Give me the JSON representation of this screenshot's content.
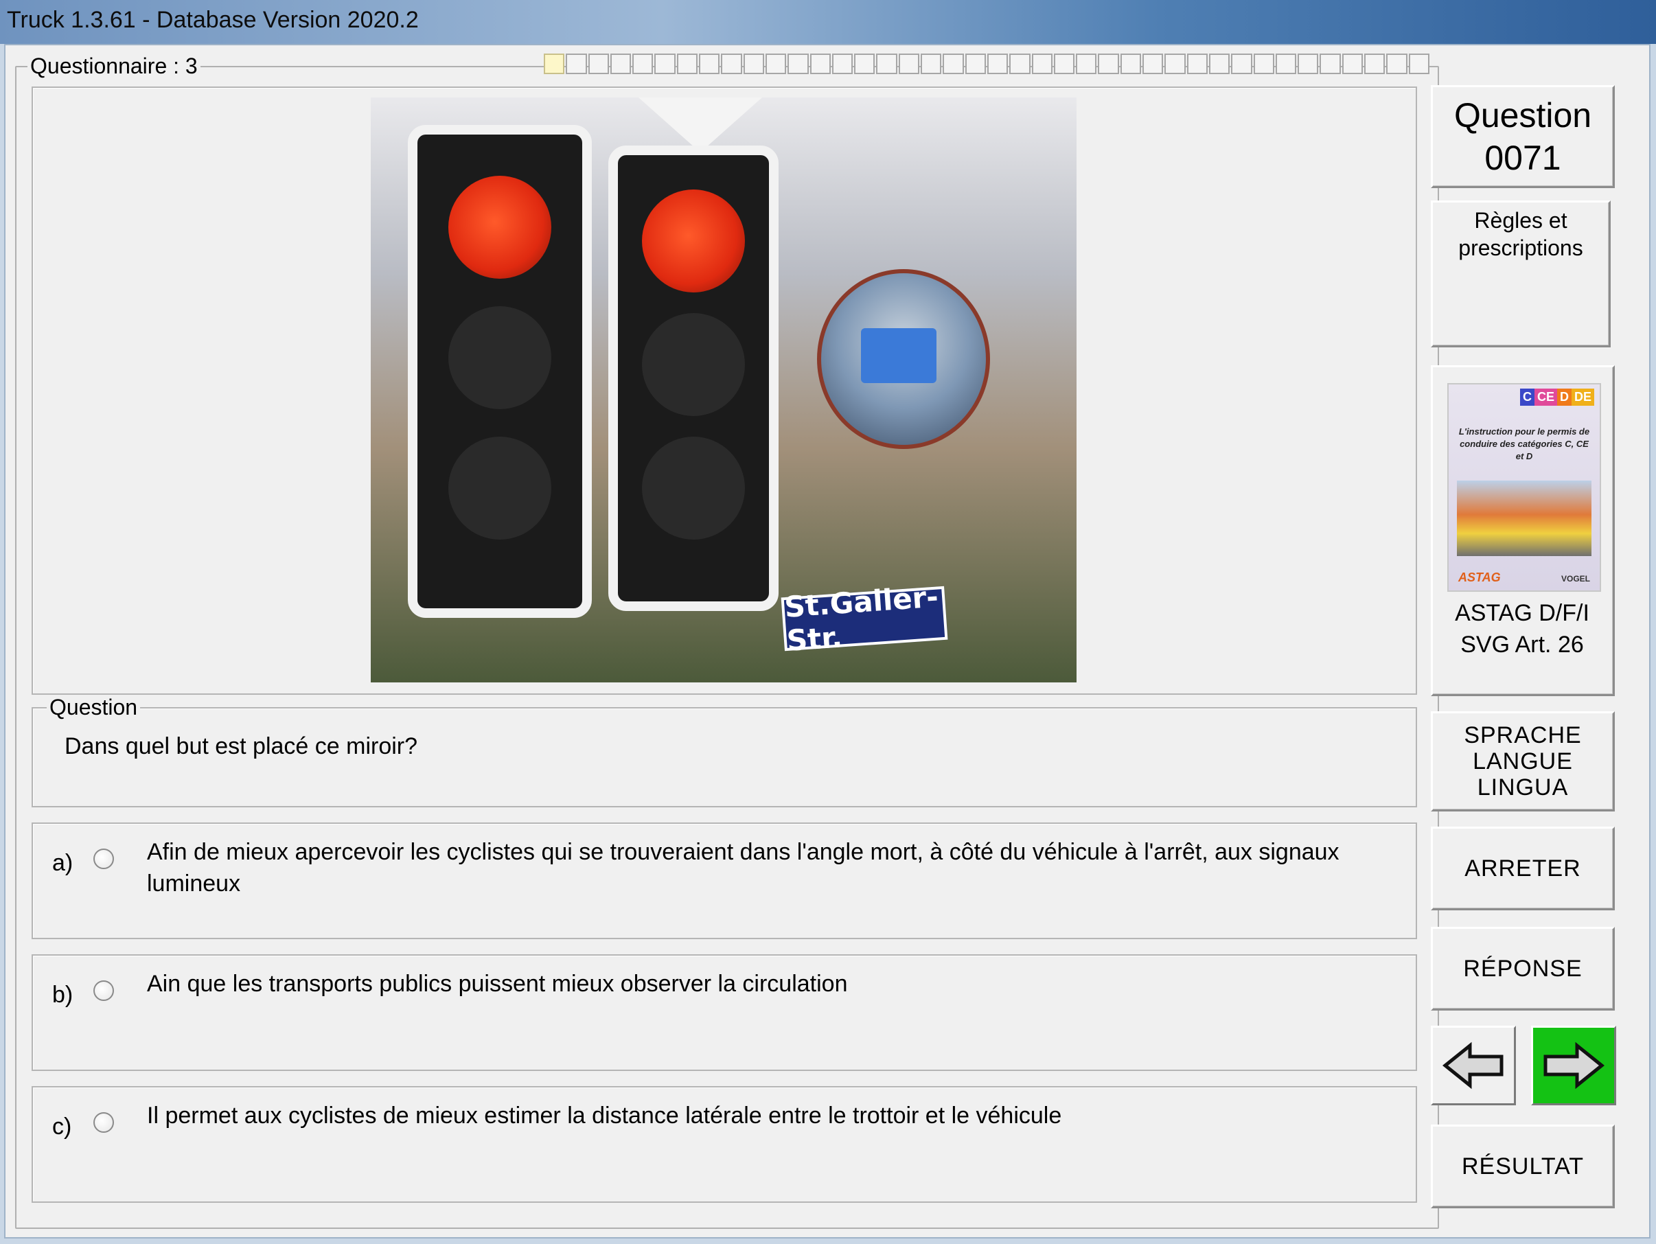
{
  "window": {
    "title": "Truck 1.3.61 - Database Version 2020.2"
  },
  "questionnaire": {
    "label": "Questionnaire : 3",
    "progress_total": 40,
    "progress_current": 1
  },
  "photo": {
    "street_sign": "St.Galler-Str."
  },
  "question": {
    "group_label": "Question",
    "text": "Dans quel but est placé ce miroir?"
  },
  "answers": [
    {
      "letter": "a)",
      "text": "Afin de mieux apercevoir les cyclistes qui se trouveraient dans l'angle mort, à côté du véhicule à l'arrêt, aux signaux lumineux"
    },
    {
      "letter": "b)",
      "text": "Ain que les transports publics puissent mieux observer la circulation"
    },
    {
      "letter": "c)",
      "text": "Il permet aux cyclistes de mieux estimer la distance latérale entre le trottoir et le véhicule"
    }
  ],
  "sidebar": {
    "question_label": "Question",
    "question_number": "0071",
    "category": "Règles et prescriptions",
    "book": {
      "categories": [
        "C",
        "CE",
        "D",
        "DE"
      ],
      "title": "L'instruction pour le permis de conduire des catégories C, CE et D",
      "logo_left": "ASTAG",
      "logo_right": "VOGEL"
    },
    "source_line1": "ASTAG D/F/I",
    "source_line2": "SVG Art. 26",
    "language_button": "SPRACHE\nLANGUE\nLINGUA",
    "stop_button": "ARRETER",
    "answer_button": "RÉPONSE",
    "result_button": "RÉSULTAT"
  },
  "colors": {
    "next_button_bg": "#14c214",
    "progress_current": "#fdf7c9",
    "book_cat_colors": [
      "#3a48c8",
      "#e04a9a",
      "#f07a1a",
      "#f0b01a"
    ]
  },
  "icons": {
    "prev": "arrow-left-icon",
    "next": "arrow-right-icon"
  }
}
